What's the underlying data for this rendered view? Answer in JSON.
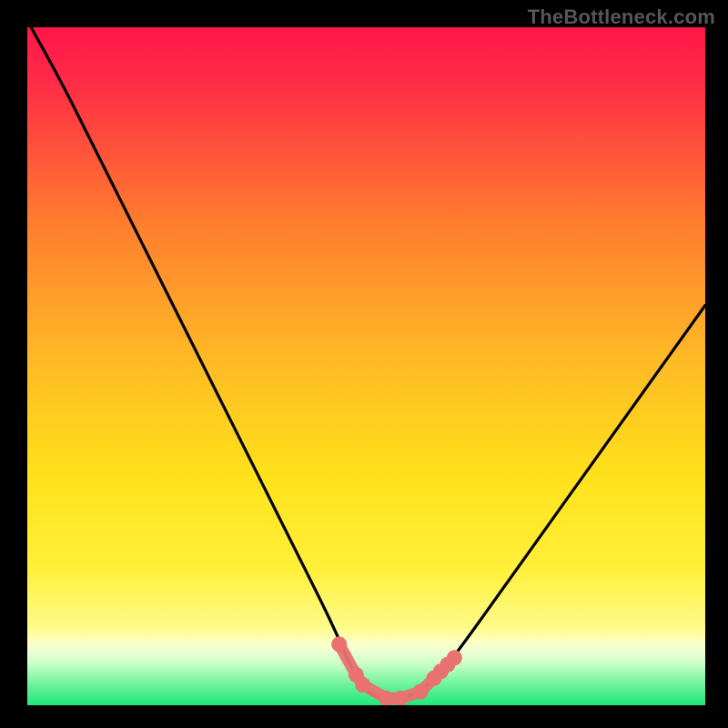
{
  "watermark": "TheBottleneck.com",
  "colors": {
    "frame_bg": "#000000",
    "grad_top": "#ff1648",
    "grad_mid1": "#ff8c2a",
    "grad_mid2": "#ffe11a",
    "grad_low": "#fff77a",
    "grad_green": "#1ee87b",
    "curve": "#000000",
    "marker": "#e97171"
  },
  "chart_data": {
    "type": "line",
    "title": "",
    "xlabel": "",
    "ylabel": "",
    "xlim": [
      0,
      100
    ],
    "ylim": [
      0,
      100
    ],
    "x": [
      0,
      5,
      10,
      15,
      20,
      25,
      30,
      35,
      40,
      45,
      48,
      50,
      52,
      55,
      58,
      60,
      62,
      65,
      70,
      75,
      80,
      85,
      90,
      95,
      100
    ],
    "values": [
      101,
      92,
      82,
      72,
      62,
      52,
      42,
      32,
      22,
      12,
      5,
      2,
      1,
      1,
      2,
      4,
      6,
      10,
      17,
      24,
      31,
      38,
      45,
      52,
      59
    ],
    "markers_x": [
      46,
      48.5,
      49.5,
      53,
      55,
      58,
      60,
      61,
      62,
      63
    ],
    "markers_y": [
      9,
      4.5,
      3,
      1,
      1,
      2,
      4,
      5,
      6,
      7
    ]
  }
}
